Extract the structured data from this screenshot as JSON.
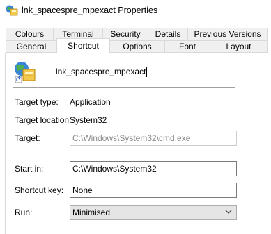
{
  "window": {
    "title": "lnk_spacespre_mpexact Properties",
    "icon": "shortcut-app-icon"
  },
  "tabs": {
    "row1": [
      "Colours",
      "Terminal",
      "Security",
      "Details",
      "Previous Versions"
    ],
    "row2": [
      "General",
      "Shortcut",
      "Options",
      "Font",
      "Layout"
    ],
    "selected": "Shortcut"
  },
  "shortcut": {
    "name": "lnk_spacespre_mpexact",
    "target_type_label": "Target type:",
    "target_type": "Application",
    "target_location_label": "Target location:",
    "target_location": "System32",
    "target_label": "Target:",
    "target": "C:\\Windows\\System32\\cmd.exe",
    "start_in_label": "Start in:",
    "start_in": "C:\\Windows\\System32",
    "shortcut_key_label": "Shortcut key:",
    "shortcut_key": "None",
    "run_label": "Run:",
    "run": "Minimised"
  }
}
